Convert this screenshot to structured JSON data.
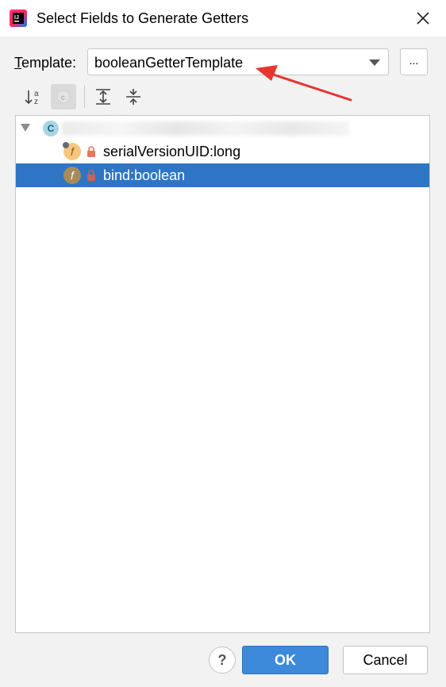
{
  "window": {
    "title": "Select Fields to Generate Getters",
    "app_icon": "intellij-idea-icon",
    "close_icon": "close-icon"
  },
  "template": {
    "label_mnemonic": "T",
    "label_rest": "emplate:",
    "selected": "booleanGetterTemplate",
    "browse_label": "..."
  },
  "toolbar": {
    "icons": [
      "sort-alphabetically-icon",
      "show-classes-icon",
      "expand-all-icon",
      "collapse-all-icon"
    ]
  },
  "tree": {
    "class_icon_letter": "C",
    "fields": [
      {
        "icon_letter": "f",
        "label": "serialVersionUID:long",
        "selected": false
      },
      {
        "icon_letter": "f",
        "label": "bind:boolean",
        "selected": true
      }
    ]
  },
  "buttons": {
    "help": "?",
    "ok": "OK",
    "cancel": "Cancel"
  },
  "colors": {
    "selection": "#2f75c5",
    "ok_button": "#3c8ad9",
    "annotation_arrow": "#e8352f"
  }
}
